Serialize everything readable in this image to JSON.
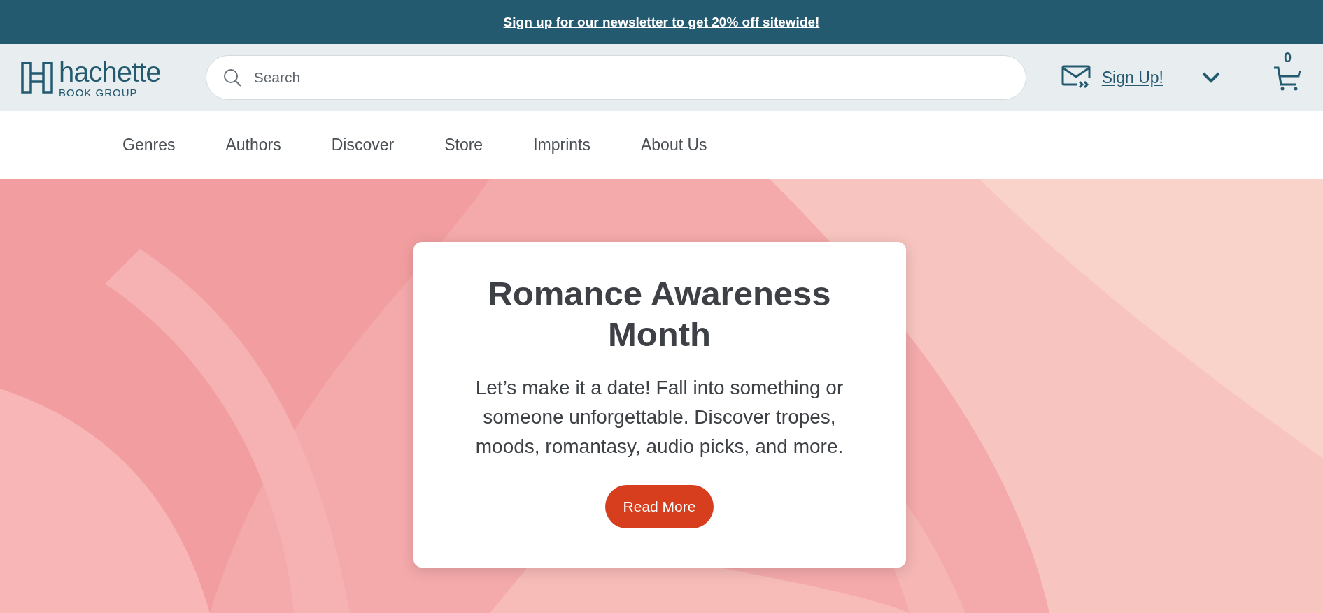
{
  "banner": {
    "text": "Sign up for our newsletter to get 20% off sitewide!"
  },
  "header": {
    "logo": {
      "name": "hachette",
      "subtitle": "BOOK GROUP"
    },
    "search": {
      "placeholder": "Search"
    },
    "signup": "Sign Up!",
    "cart_count": "0"
  },
  "nav": [
    {
      "label": "Genres"
    },
    {
      "label": "Authors"
    },
    {
      "label": "Discover"
    },
    {
      "label": "Store"
    },
    {
      "label": "Imprints"
    },
    {
      "label": "About Us"
    }
  ],
  "hero": {
    "title": "Romance Awareness Month",
    "text": "Let’s make it a date! Fall into something or someone unforgettable. Discover tropes, moods, romantasy, audio picks, and more.",
    "button": "Read More"
  }
}
